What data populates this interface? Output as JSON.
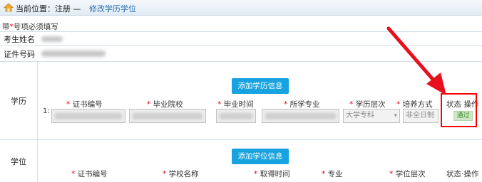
{
  "breadcrumb": {
    "prefix": "当前位置：注册 —",
    "current": "修改学历学位"
  },
  "required_note": {
    "before": "带",
    "star": "*",
    "after": "号项必须填写"
  },
  "rows": {
    "name_label": "考生姓名",
    "cert_label": "证件号码",
    "education_label": "学历",
    "degree_label": "学位"
  },
  "education": {
    "add_button": "添加学历信息",
    "columns": [
      "证书编号",
      "毕业院校",
      "毕业时间",
      "所学专业",
      "学历层次",
      "培养方式",
      "状态",
      "操作"
    ],
    "row": {
      "index": "1:",
      "level": "大学专科",
      "mode": "非全日制",
      "status": "通过"
    }
  },
  "degree": {
    "add_button": "添加学位信息",
    "columns": [
      "证书编号",
      "学校名称",
      "取得时间",
      "专业",
      "学位层次",
      "状态",
      "操作"
    ]
  },
  "colors": {
    "accent": "#17a2e0",
    "required_star": "#e0001b",
    "highlight": "#ff0000",
    "status_pass": "#3a8a2a"
  },
  "icons": [
    "home-icon",
    "red-arrow-annotation"
  ]
}
